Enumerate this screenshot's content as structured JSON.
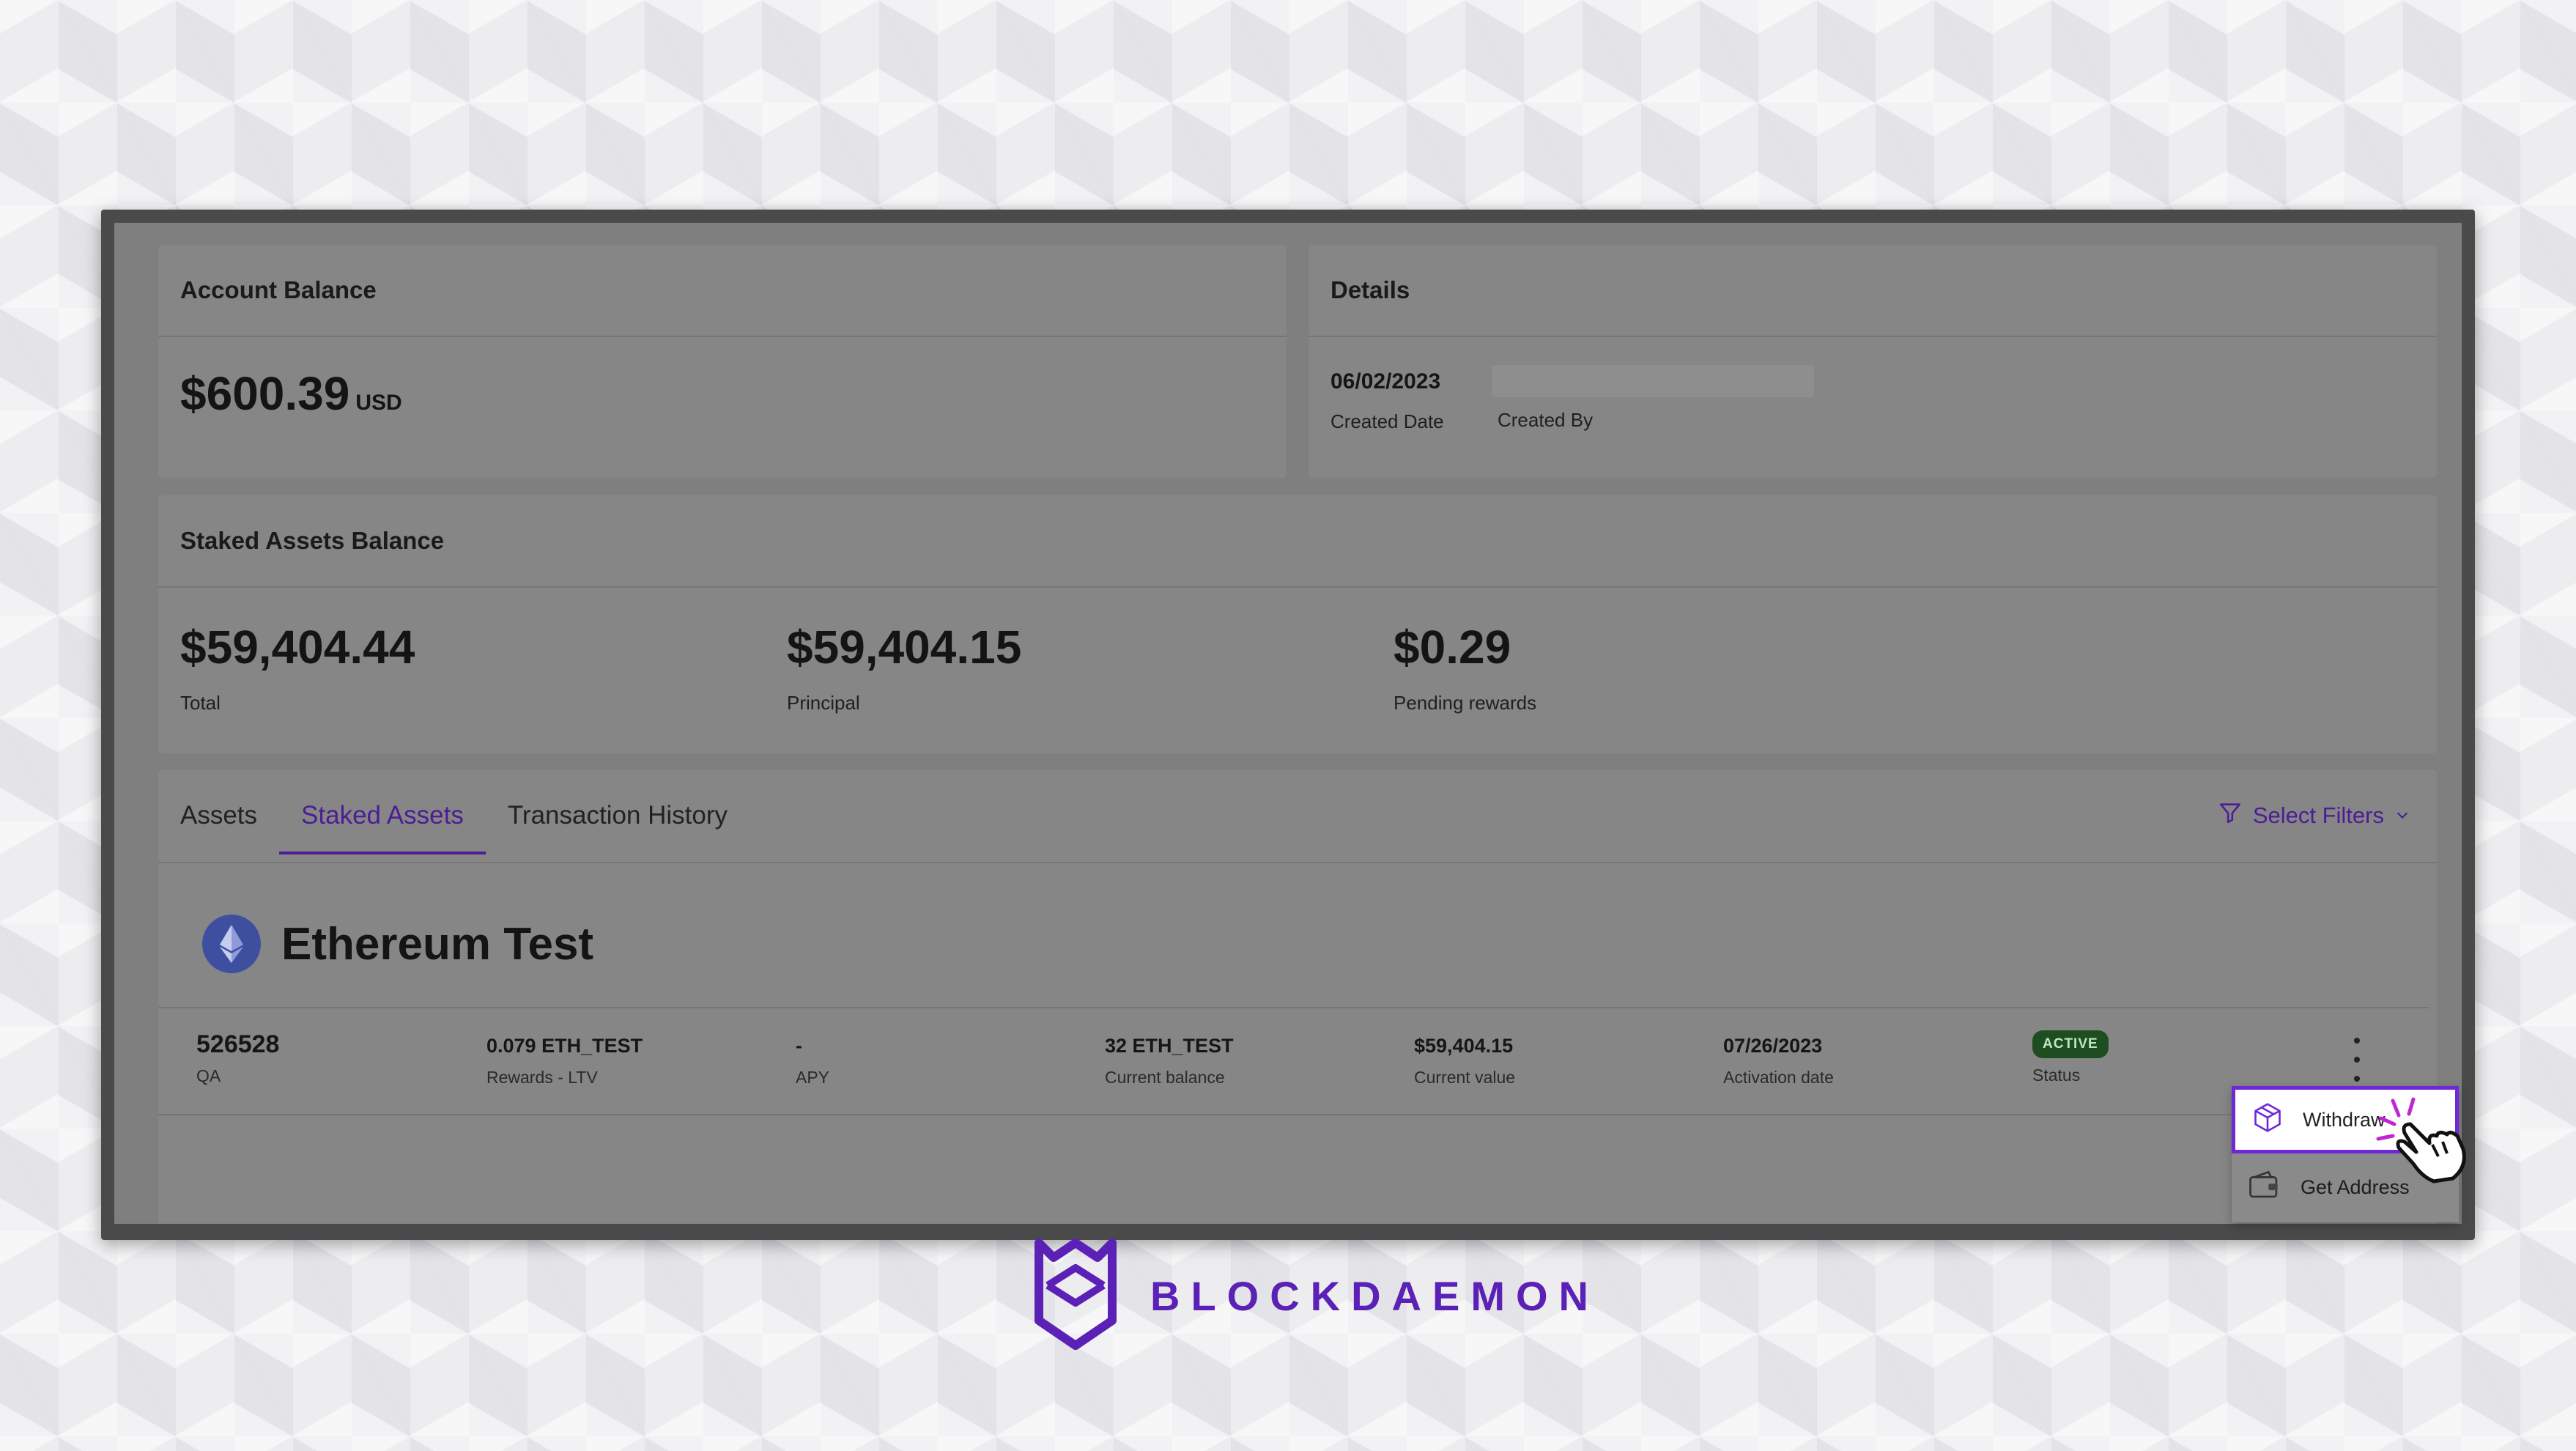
{
  "account_balance": {
    "title": "Account Balance",
    "amount": "$600.39",
    "currency": "USD"
  },
  "details": {
    "title": "Details",
    "created_date_value": "06/02/2023",
    "created_date_label": "Created Date",
    "created_by_label": "Created By"
  },
  "staked_balance": {
    "title": "Staked Assets Balance",
    "metrics": [
      {
        "value": "$59,404.44",
        "label": "Total"
      },
      {
        "value": "$59,404.15",
        "label": "Principal"
      },
      {
        "value": "$0.29",
        "label": "Pending rewards"
      }
    ]
  },
  "tabs": [
    {
      "label": "Assets",
      "active": false
    },
    {
      "label": "Staked Assets",
      "active": true
    },
    {
      "label": "Transaction History",
      "active": false
    }
  ],
  "filters": {
    "label": "Select Filters"
  },
  "asset": {
    "name": "Ethereum Test"
  },
  "row": {
    "id": "526528",
    "id_label": "QA",
    "rewards": "0.079 ETH_TEST",
    "rewards_label": "Rewards - LTV",
    "apy": "-",
    "apy_label": "APY",
    "balance": "32 ETH_TEST",
    "balance_label": "Current balance",
    "value": "$59,404.15",
    "value_label": "Current value",
    "activation": "07/26/2023",
    "activation_label": "Activation date",
    "status": "ACTIVE",
    "status_label": "Status"
  },
  "menu": {
    "withdraw": "Withdraw",
    "get_address": "Get Address"
  },
  "brand": {
    "name": "BLOCKDAEMON"
  },
  "colors": {
    "accent": "#4c1d95",
    "brand": "#5b21b6",
    "status_active": "#1f4d22"
  }
}
